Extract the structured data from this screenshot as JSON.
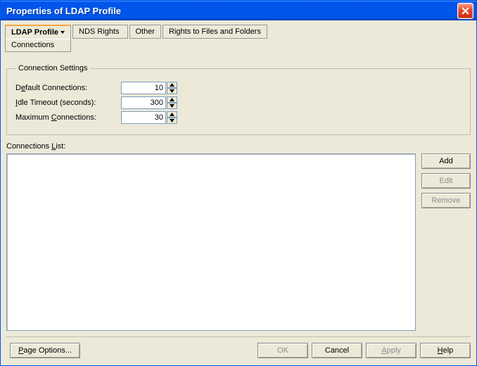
{
  "window": {
    "title": "Properties of LDAP Profile"
  },
  "tabs": {
    "ldap_profile": "LDAP Profile",
    "ldap_profile_sub": "Connections",
    "nds_rights": "NDS Rights",
    "other": "Other",
    "rights_files": "Rights to Files and Folders"
  },
  "settings": {
    "legend": "Connection Settings",
    "default_label": "Default Connections:",
    "default_value": "10",
    "idle_label": "Idle Timeout (seconds):",
    "idle_value": "300",
    "max_label": "Maximum Connections:",
    "max_value": "30"
  },
  "list": {
    "label": "Connections List:",
    "add": "Add",
    "edit": "Edit",
    "remove": "Remove"
  },
  "buttons": {
    "page_options": "Page Options...",
    "ok": "OK",
    "cancel": "Cancel",
    "apply": "Apply",
    "help": "Help"
  }
}
